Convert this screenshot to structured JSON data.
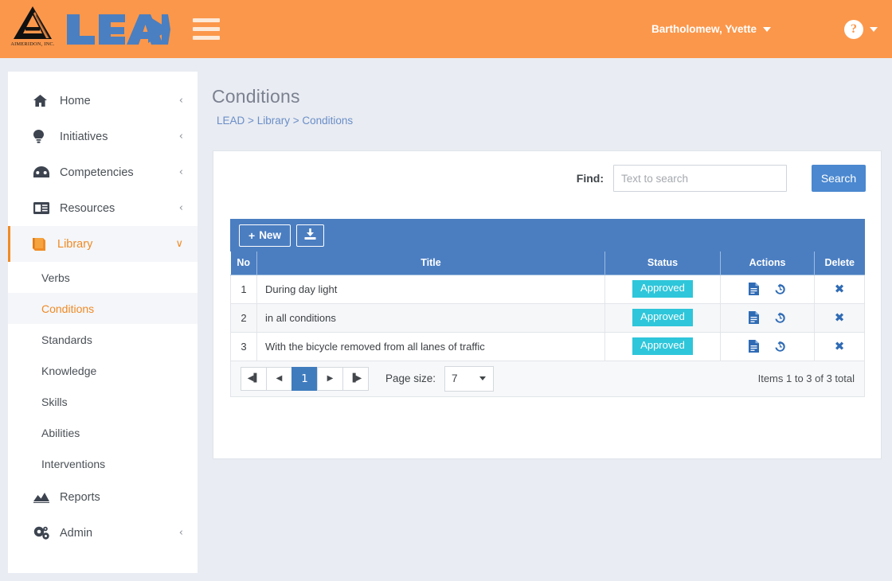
{
  "header": {
    "logo_word": "LEAD",
    "logo_company": "AIMERIDON, INC.",
    "menu_icon": "hamburger-icon",
    "user_name": "Bartholomew, Yvette",
    "help_icon": "question-mark-icon",
    "brand_color": "#fb974b"
  },
  "sidebar": {
    "items": [
      {
        "label": "Home",
        "icon": "home-icon",
        "chevron": "‹",
        "active": false
      },
      {
        "label": "Initiatives",
        "icon": "lightbulb-icon",
        "chevron": "‹",
        "active": false
      },
      {
        "label": "Competencies",
        "icon": "dashboard-icon",
        "chevron": "‹",
        "active": false
      },
      {
        "label": "Resources",
        "icon": "newspaper-icon",
        "chevron": "‹",
        "active": false
      },
      {
        "label": "Library",
        "icon": "book-icon",
        "chevron": "∨",
        "active": true
      },
      {
        "label": "Reports",
        "icon": "chart-area-icon",
        "chevron": "",
        "active": false
      },
      {
        "label": "Admin",
        "icon": "gears-icon",
        "chevron": "‹",
        "active": false
      }
    ],
    "sub_items": [
      {
        "label": "Verbs",
        "active": false
      },
      {
        "label": "Conditions",
        "active": true
      },
      {
        "label": "Standards",
        "active": false
      },
      {
        "label": "Knowledge",
        "active": false
      },
      {
        "label": "Skills",
        "active": false
      },
      {
        "label": "Abilities",
        "active": false
      },
      {
        "label": "Interventions",
        "active": false
      }
    ],
    "active_color": "#f08a24"
  },
  "page": {
    "title": "Conditions",
    "breadcrumb": {
      "root": "LEAD",
      "sep1": ">",
      "parent": "Library",
      "sep2": ">",
      "current": "Conditions"
    }
  },
  "search": {
    "find_label": "Find:",
    "placeholder": "Text to search",
    "value": "",
    "button_label": "Search",
    "button_color": "#4b88d0"
  },
  "toolbar": {
    "new_label": "New",
    "new_plus": "+",
    "export_icon": "download-icon",
    "bar_color": "#4b7ec1"
  },
  "table": {
    "columns": [
      "No",
      "Title",
      "Status",
      "Actions",
      "Delete"
    ],
    "rows": [
      {
        "no": "1",
        "title": "During day light",
        "status": "Approved",
        "actions": [
          "document-icon",
          "history-icon"
        ],
        "delete": "✖"
      },
      {
        "no": "2",
        "title": "in all conditions",
        "status": "Approved",
        "actions": [
          "document-icon",
          "history-icon"
        ],
        "delete": "✖"
      },
      {
        "no": "3",
        "title": "With the bicycle removed from all lanes of traffic",
        "status": "Approved",
        "actions": [
          "document-icon",
          "history-icon"
        ],
        "delete": "✖"
      }
    ],
    "status_color": "#2ec6da"
  },
  "pager": {
    "first_icon": "◀▌",
    "prev_icon": "◀",
    "current_page": "1",
    "next_icon": "▶",
    "last_icon": "▐▶",
    "page_size_label": "Page size:",
    "page_size_value": "7",
    "total_text": "Items 1 to 3 of 3 total"
  }
}
